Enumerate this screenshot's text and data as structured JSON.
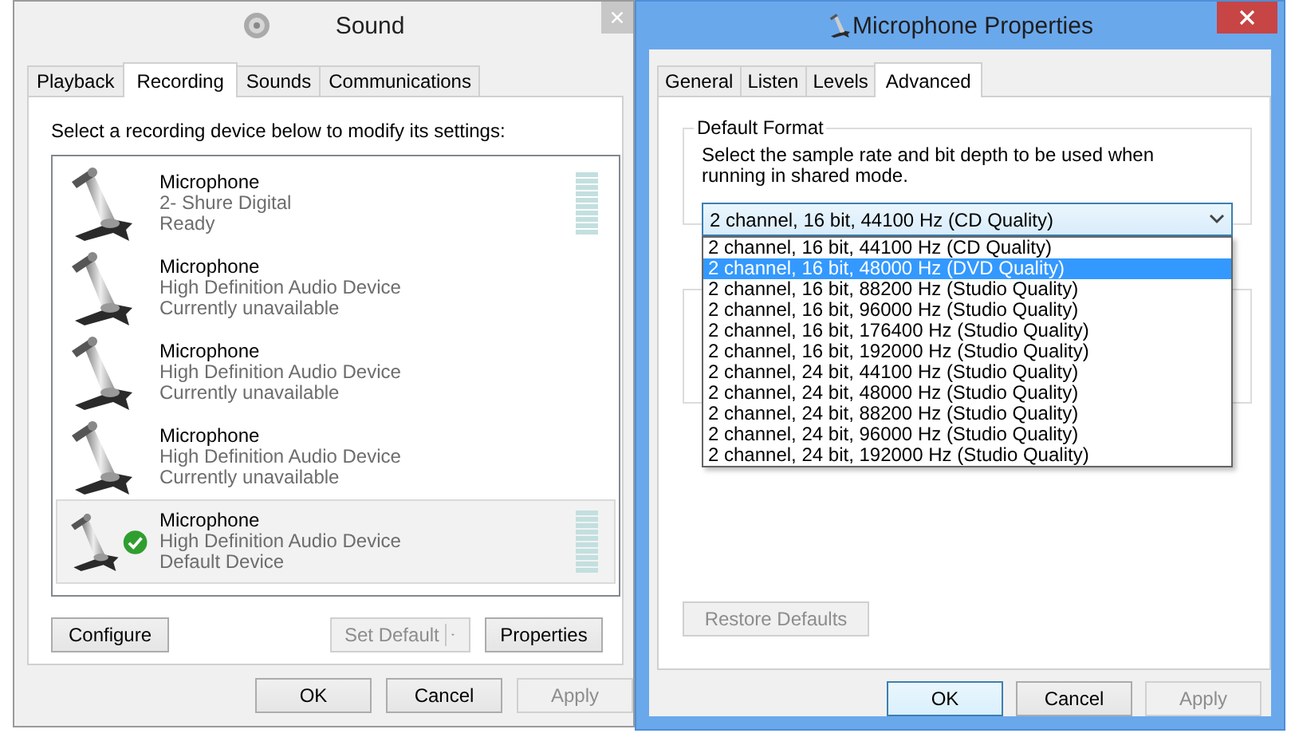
{
  "sound_window": {
    "title": "Sound",
    "tabs": [
      {
        "label": "Playback",
        "selected": false
      },
      {
        "label": "Recording",
        "selected": true
      },
      {
        "label": "Sounds",
        "selected": false
      },
      {
        "label": "Communications",
        "selected": false
      }
    ],
    "instruction": "Select a recording device below to modify its settings:",
    "devices": [
      {
        "name": "Microphone",
        "description": "2- Shure Digital",
        "status": "Ready",
        "has_meter": true,
        "default": false,
        "selected": false
      },
      {
        "name": "Microphone",
        "description": "High Definition Audio Device",
        "status": "Currently unavailable",
        "has_meter": false,
        "default": false,
        "selected": false
      },
      {
        "name": "Microphone",
        "description": "High Definition Audio Device",
        "status": "Currently unavailable",
        "has_meter": false,
        "default": false,
        "selected": false
      },
      {
        "name": "Microphone",
        "description": "High Definition Audio Device",
        "status": "Currently unavailable",
        "has_meter": false,
        "default": false,
        "selected": false
      },
      {
        "name": "Microphone",
        "description": "High Definition Audio Device",
        "status": "Default Device",
        "has_meter": true,
        "default": true,
        "selected": true
      }
    ],
    "configure_button": {
      "label": "Configure",
      "disabled": false
    },
    "set_default_button": {
      "label": "Set Default",
      "disabled": true
    },
    "properties_button": {
      "label": "Properties",
      "disabled": false
    },
    "dialog_buttons": [
      {
        "label": "OK",
        "disabled": false
      },
      {
        "label": "Cancel",
        "disabled": false
      },
      {
        "label": "Apply",
        "disabled": true
      }
    ]
  },
  "properties_window": {
    "title": "Microphone Properties",
    "tabs": [
      {
        "label": "General",
        "selected": false
      },
      {
        "label": "Listen",
        "selected": false
      },
      {
        "label": "Levels",
        "selected": false
      },
      {
        "label": "Advanced",
        "selected": true
      }
    ],
    "group_title": "Default Format",
    "description": "Select the sample rate and bit depth to be used when running in shared mode.",
    "format_select": {
      "value": "2 channel, 16 bit, 44100 Hz (CD Quality)"
    },
    "format_options": [
      {
        "label": "2 channel, 16 bit, 44100 Hz (CD Quality)",
        "selected": false
      },
      {
        "label": "2 channel, 16 bit, 48000 Hz (DVD Quality)",
        "selected": true
      },
      {
        "label": "2 channel, 16 bit, 88200 Hz (Studio Quality)",
        "selected": false
      },
      {
        "label": "2 channel, 16 bit, 96000 Hz (Studio Quality)",
        "selected": false
      },
      {
        "label": "2 channel, 16 bit, 176400 Hz (Studio Quality)",
        "selected": false
      },
      {
        "label": "2 channel, 16 bit, 192000 Hz (Studio Quality)",
        "selected": false
      },
      {
        "label": "2 channel, 24 bit, 44100 Hz (Studio Quality)",
        "selected": false
      },
      {
        "label": "2 channel, 24 bit, 48000 Hz (Studio Quality)",
        "selected": false
      },
      {
        "label": "2 channel, 24 bit, 88200 Hz (Studio Quality)",
        "selected": false
      },
      {
        "label": "2 channel, 24 bit, 96000 Hz (Studio Quality)",
        "selected": false
      },
      {
        "label": "2 channel, 24 bit, 192000 Hz (Studio Quality)",
        "selected": false
      }
    ],
    "restore_button": {
      "label": "Restore Defaults",
      "disabled": true
    },
    "dialog_buttons": [
      {
        "label": "OK",
        "disabled": false,
        "focused": true
      },
      {
        "label": "Cancel",
        "disabled": false,
        "focused": false
      },
      {
        "label": "Apply",
        "disabled": true,
        "focused": false
      }
    ]
  }
}
